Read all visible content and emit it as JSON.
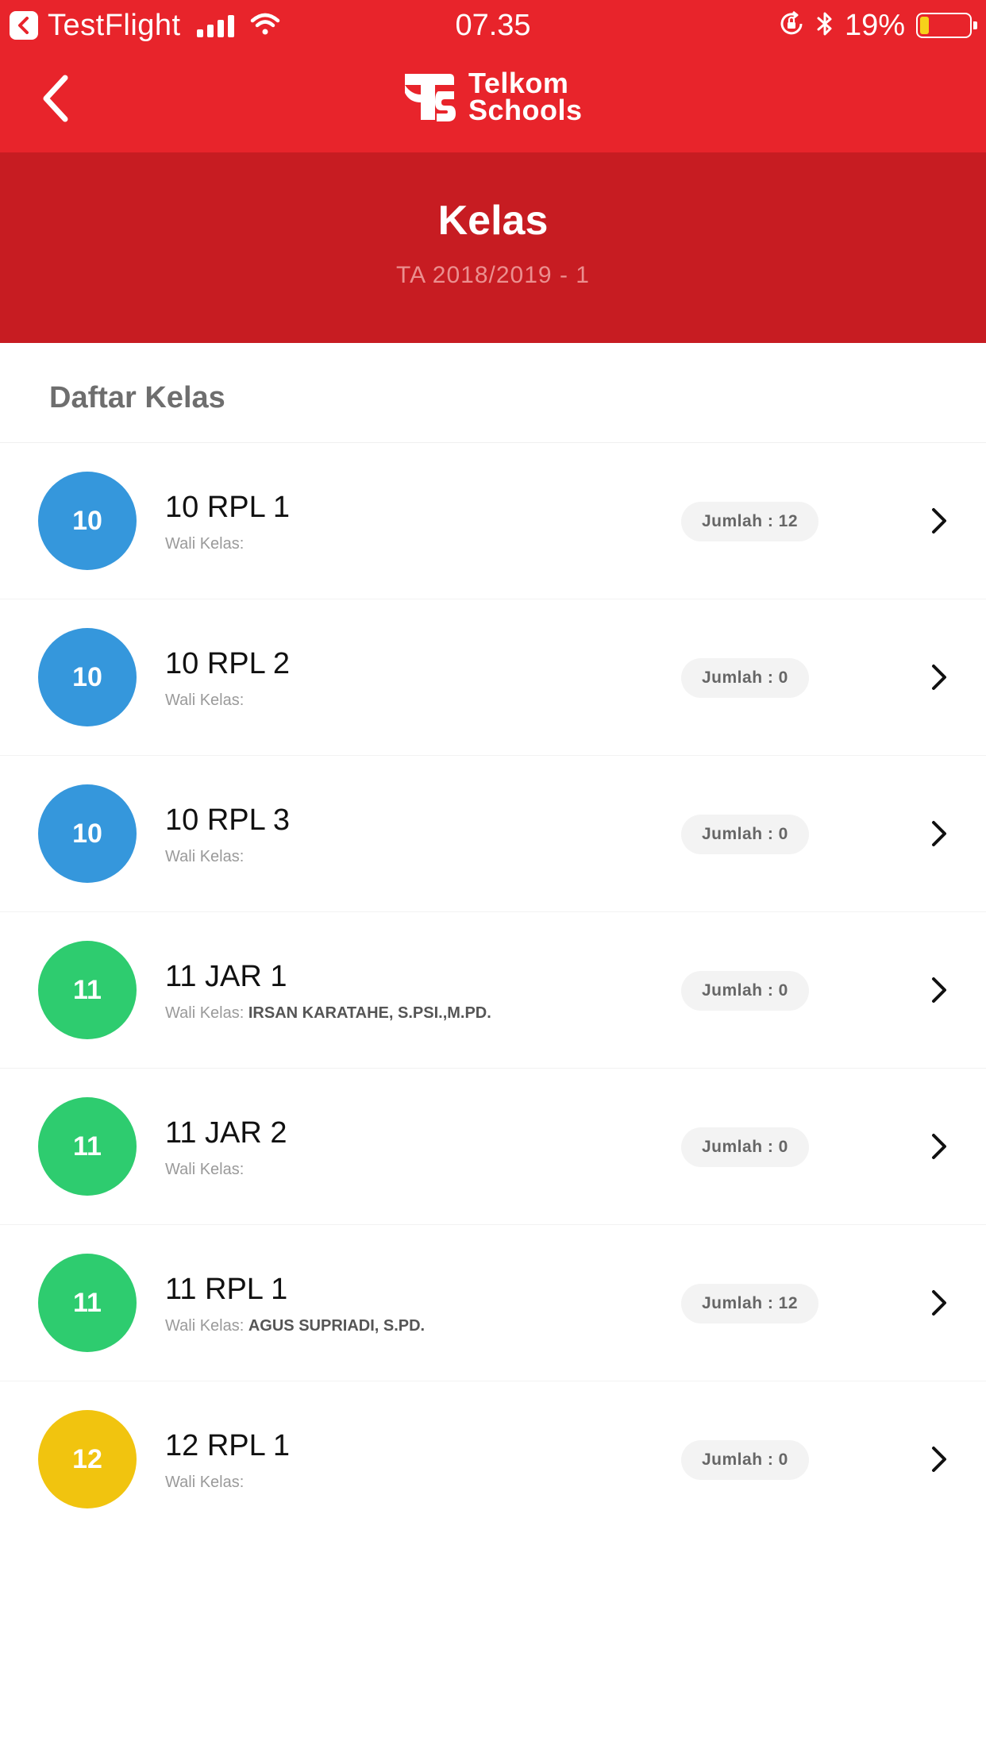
{
  "status_bar": {
    "carrier": "TestFlight",
    "time": "07.35",
    "battery": "19%",
    "battery_level": 0.19,
    "icons": [
      "testflight-back-icon",
      "signal-icon",
      "wifi-icon",
      "orientation-lock-icon",
      "bluetooth-icon",
      "battery-icon"
    ]
  },
  "nav": {
    "back_icon": "chevron-left-icon",
    "brand_line1": "Telkom",
    "brand_line2": "Schools"
  },
  "header": {
    "title": "Kelas",
    "subtitle": "TA 2018/2019 - 1"
  },
  "section_title": "Daftar Kelas",
  "classes": [
    {
      "grade": "10",
      "name": "10 RPL 1",
      "wali_label": "Wali Kelas:",
      "wali_name": "",
      "count": "Jumlah : 12",
      "color": "#3597dc"
    },
    {
      "grade": "10",
      "name": "10 RPL 2",
      "wali_label": "Wali Kelas:",
      "wali_name": "",
      "count": "Jumlah : 0",
      "color": "#3597dc"
    },
    {
      "grade": "10",
      "name": "10 RPL 3",
      "wali_label": "Wali Kelas:",
      "wali_name": "",
      "count": "Jumlah : 0",
      "color": "#3597dc"
    },
    {
      "grade": "11",
      "name": "11 JAR 1",
      "wali_label": "Wali Kelas:",
      "wali_name": "IRSAN KARATAHE, S.PSI.,M.PD.",
      "count": "Jumlah : 0",
      "color": "#2ecc6f"
    },
    {
      "grade": "11",
      "name": "11 JAR 2",
      "wali_label": "Wali Kelas:",
      "wali_name": "",
      "count": "Jumlah : 0",
      "color": "#2ecc6f"
    },
    {
      "grade": "11",
      "name": "11 RPL 1",
      "wali_label": "Wali Kelas:",
      "wali_name": "AGUS SUPRIADI, S.PD.",
      "count": "Jumlah : 12",
      "color": "#2ecc6f"
    },
    {
      "grade": "12",
      "name": "12 RPL 1",
      "wali_label": "Wali Kelas:",
      "wali_name": "",
      "count": "Jumlah : 0",
      "color": "#f1c40f"
    }
  ],
  "colors": {
    "nav_red": "#e8242b",
    "header_red": "#c71c22",
    "grade10": "#3597dc",
    "grade11": "#2ecc6f",
    "grade12": "#f1c40f"
  }
}
